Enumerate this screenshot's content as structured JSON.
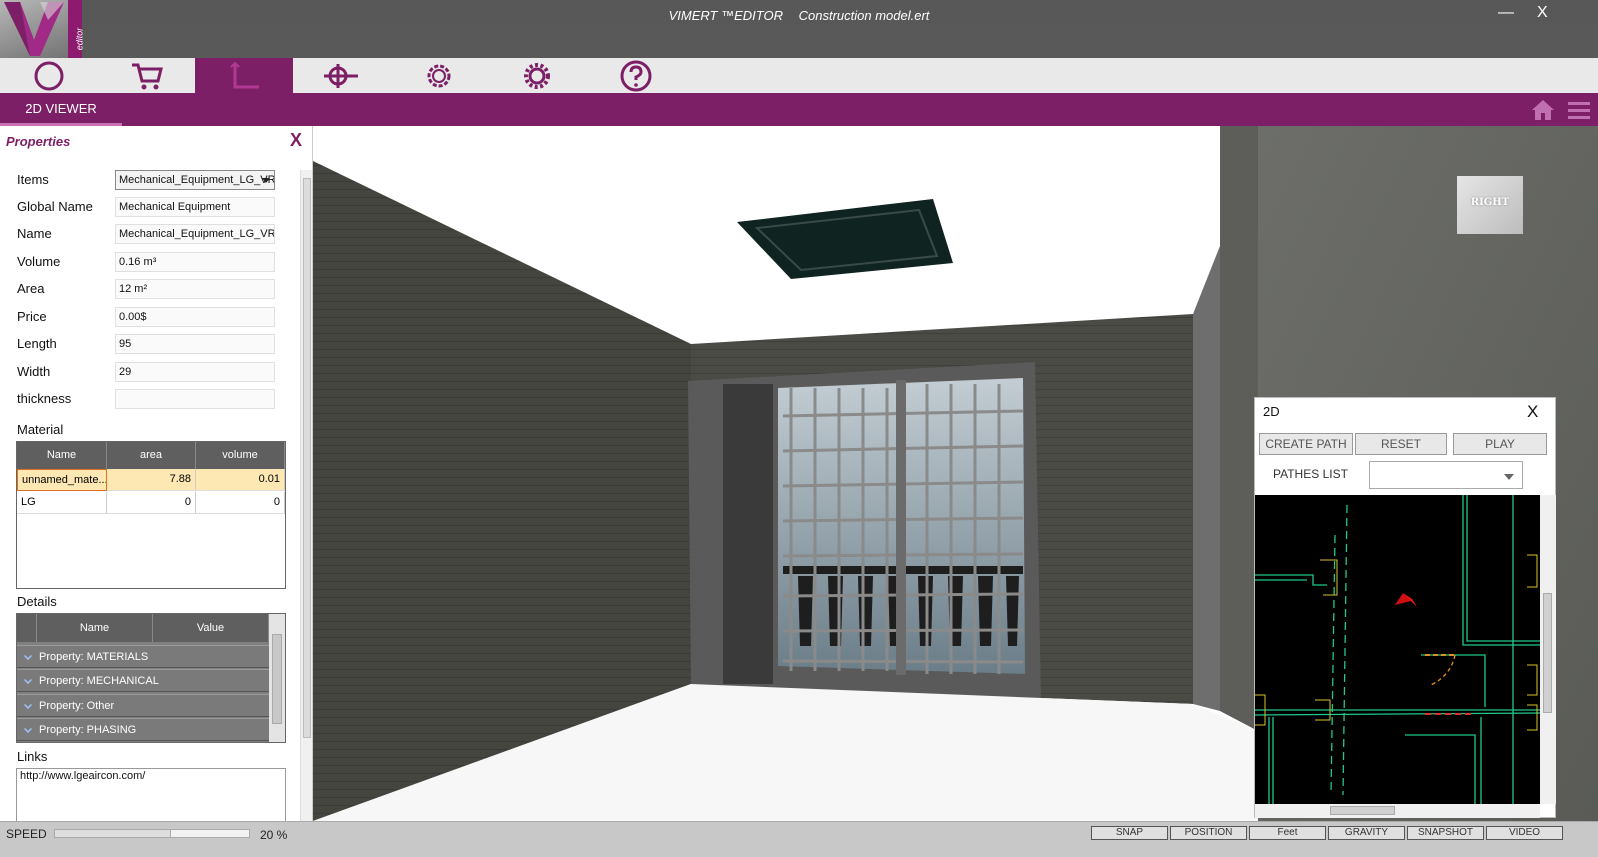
{
  "window": {
    "app_name": "VIMERT ™EDITOR",
    "file_name": "Construction model.ert",
    "logo_text": "editor",
    "minimize": "―",
    "close": "X"
  },
  "toolbar": {
    "tools": [
      "home-circle",
      "cart",
      "dimensions",
      "target",
      "gear-outline",
      "gear",
      "help"
    ],
    "active_index": 2,
    "icon_color": "#7d1f66"
  },
  "tabs": {
    "active": "2D VIEWER"
  },
  "properties": {
    "title": "Properties",
    "close": "X",
    "rows": [
      {
        "label": "Items",
        "value": "Mechanical_Equipment_LG_VRF"
      },
      {
        "label": "Global Name",
        "value": "Mechanical Equipment"
      },
      {
        "label": "Name",
        "value": "Mechanical_Equipment_LG_VRF"
      },
      {
        "label": "Volume",
        "value": "0.16 m³"
      },
      {
        "label": "Area",
        "value": "12 m²"
      },
      {
        "label": "Price",
        "value": "0.00$"
      },
      {
        "label": "Length",
        "value": "95"
      },
      {
        "label": "Width",
        "value": "29"
      },
      {
        "label": "thickness",
        "value": ""
      }
    ],
    "material": {
      "label": "Material",
      "columns": [
        "Name",
        "area",
        "volume"
      ],
      "rows": [
        {
          "name": "unnamed_mate...",
          "area": "7.88",
          "volume": "0.01"
        },
        {
          "name": "LG",
          "area": "0",
          "volume": "0"
        }
      ]
    },
    "details": {
      "label": "Details",
      "columns": [
        "Name",
        "Value"
      ],
      "rows": [
        "Property: MATERIALS",
        "Property: MECHANICAL",
        "Property: Other",
        "Property: PHASING"
      ]
    },
    "links": {
      "label": "Links",
      "value": "http://www.lgeaircon.com/"
    }
  },
  "viewport": {
    "view_cube": "RIGHT"
  },
  "panel2d": {
    "title": "2D",
    "close": "X",
    "buttons": [
      "CREATE PATH",
      "RESET",
      "PLAY"
    ],
    "pathes_label": "PATHES LIST",
    "pathes_value": ""
  },
  "statusbar": {
    "speed_label": "SPEED",
    "speed_value": "20 %",
    "speed_fraction": 0.2,
    "buttons": [
      "SNAP",
      "POSITION",
      "Feet",
      "GRAVITY",
      "SNAPSHOT",
      "VIDEO"
    ]
  }
}
